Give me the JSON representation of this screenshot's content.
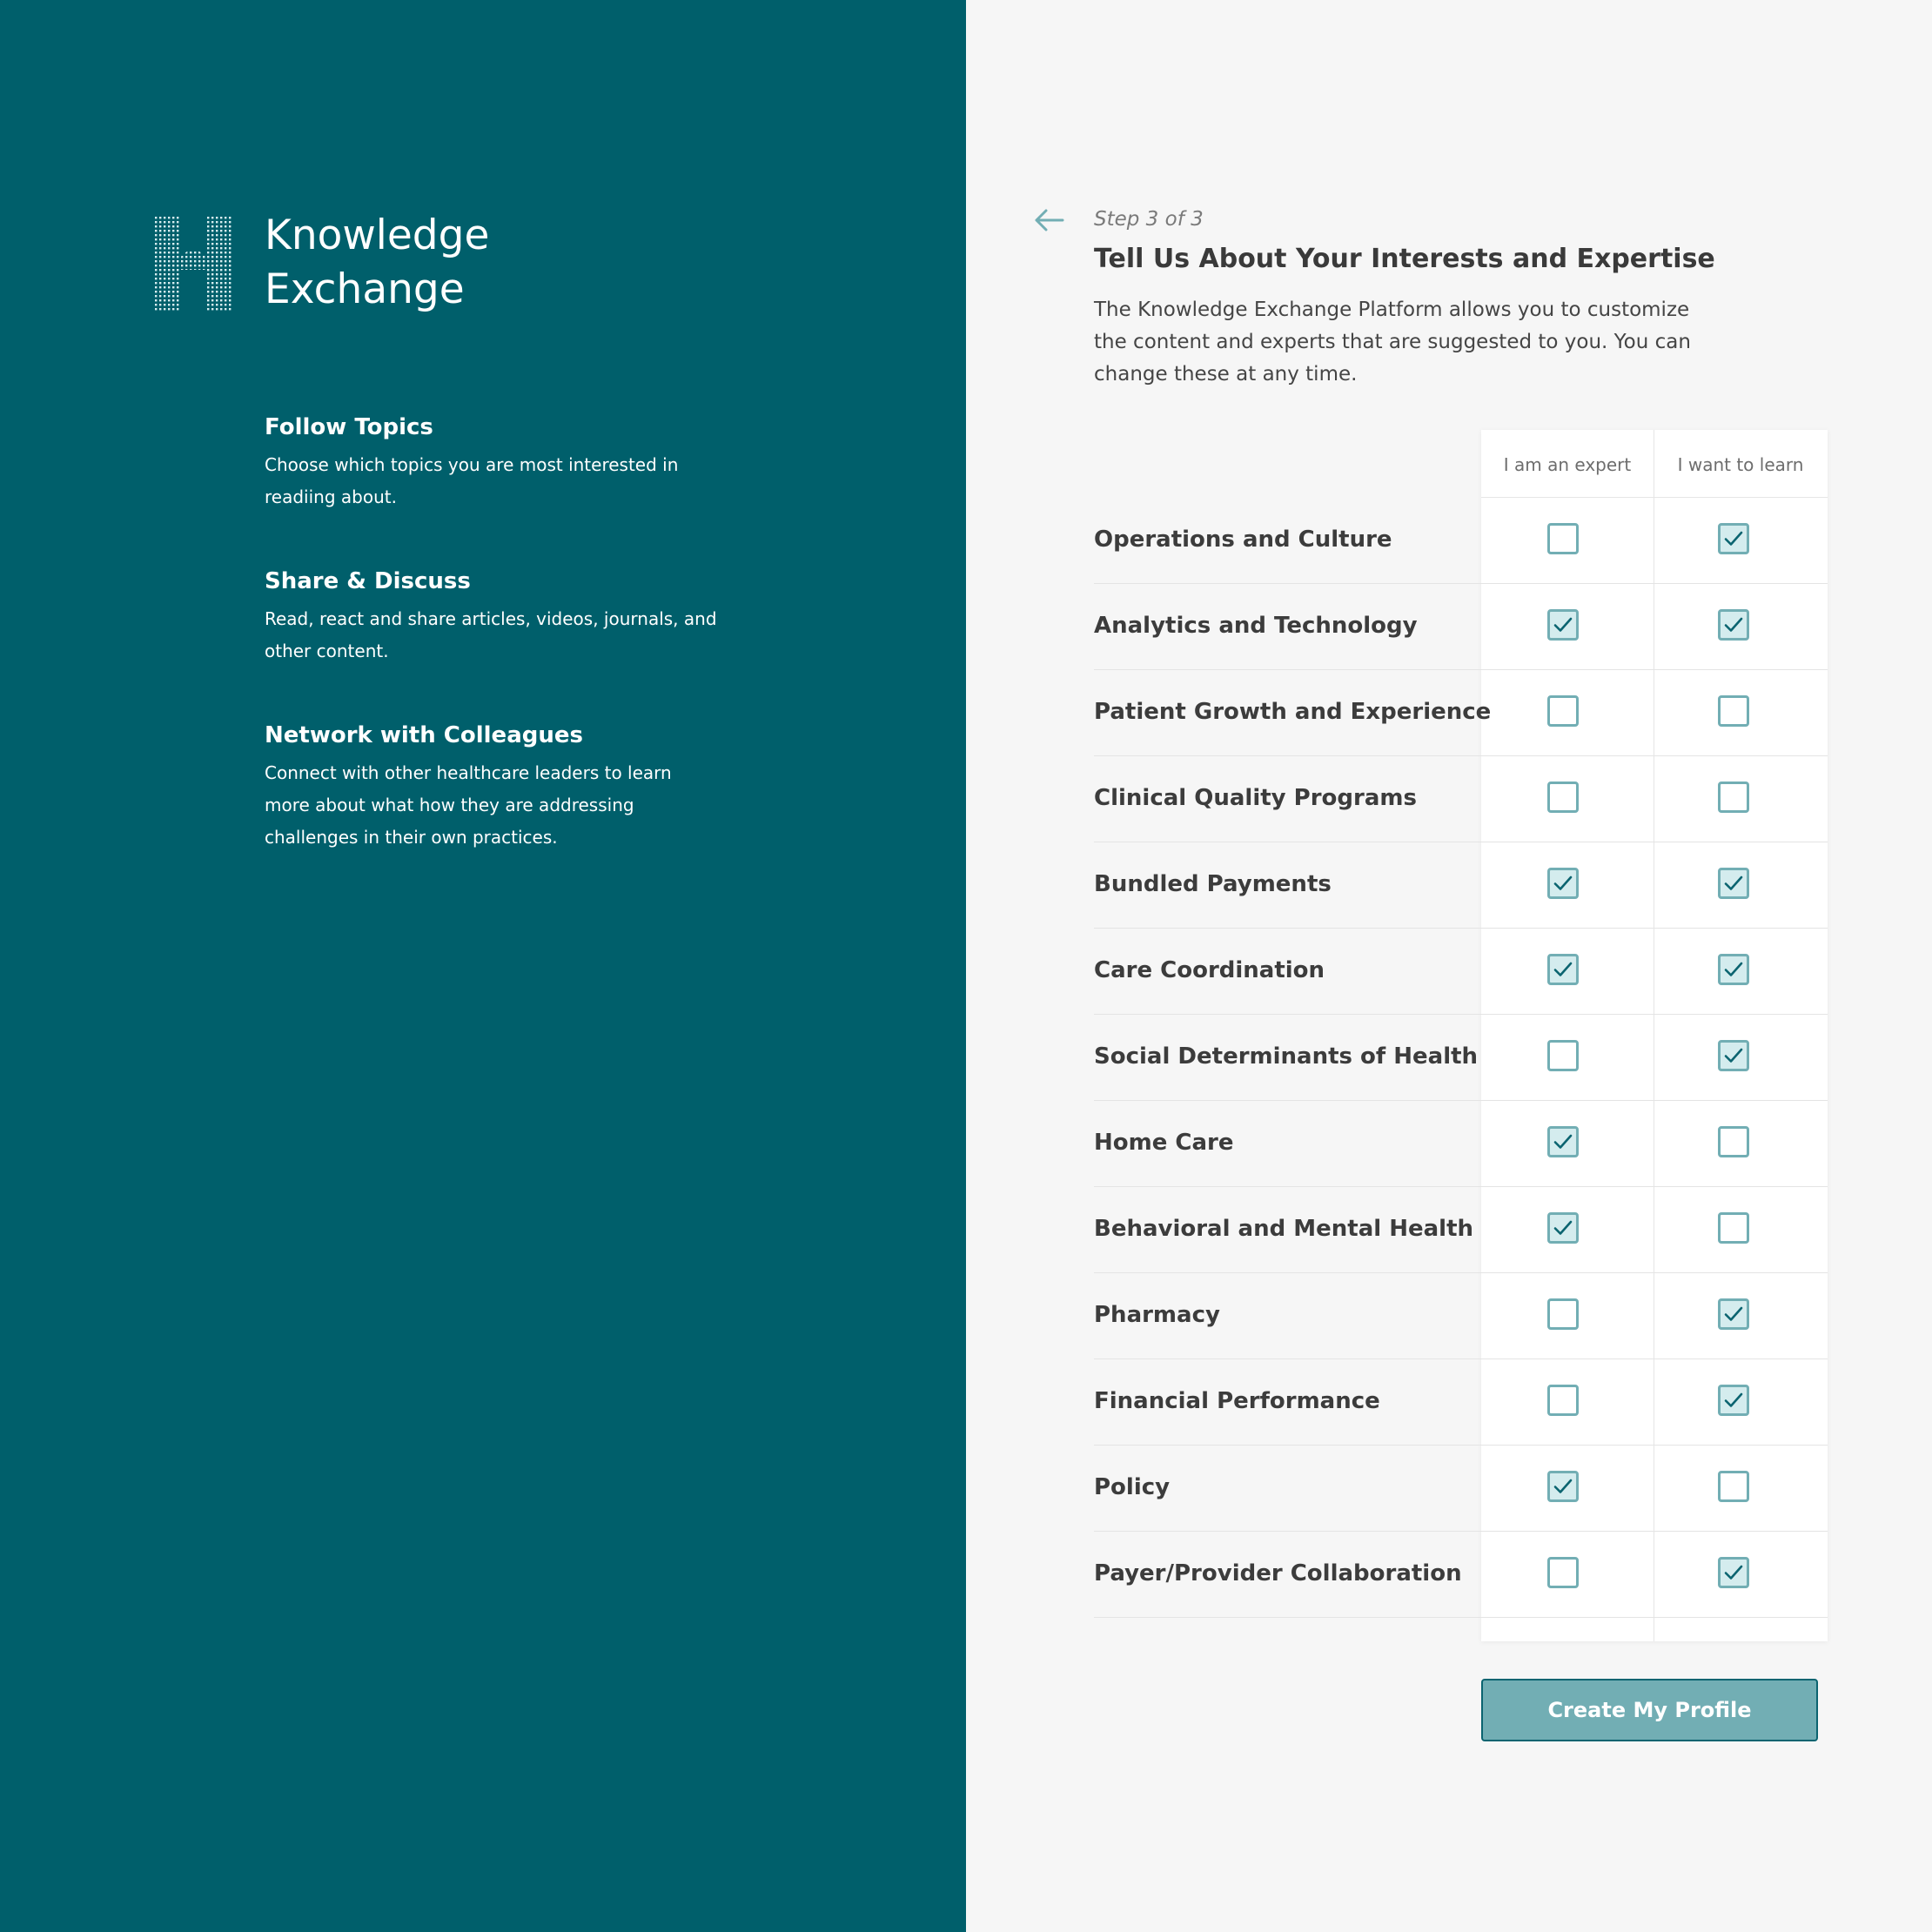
{
  "brand": {
    "line1": "Knowledge",
    "line2": "Exchange"
  },
  "features": [
    {
      "title": "Follow Topics",
      "text": "Choose which topics you are most interested in readiing about."
    },
    {
      "title": "Share & Discuss",
      "text": "Read, react and share articles, videos, journals, and other content."
    },
    {
      "title": "Network with Colleagues",
      "text": "Connect with other healthcare leaders to learn more about what how they are addressing challenges in their own practices."
    }
  ],
  "step": "Step 3 of 3",
  "title": "Tell Us About Your Interests and Expertise",
  "description": "The Knowledge Exchange Platform allows you to customize the content and experts that are suggested to you. You can change these at any time.",
  "columns": {
    "expert": "I am an expert",
    "learn": "I want to learn"
  },
  "topics": [
    {
      "label": "Operations and Culture",
      "expert": false,
      "learn": true
    },
    {
      "label": "Analytics and Technology",
      "expert": true,
      "learn": true
    },
    {
      "label": "Patient Growth and Experience",
      "expert": false,
      "learn": false
    },
    {
      "label": "Clinical Quality Programs",
      "expert": false,
      "learn": false
    },
    {
      "label": "Bundled Payments",
      "expert": true,
      "learn": true
    },
    {
      "label": "Care Coordination",
      "expert": true,
      "learn": true
    },
    {
      "label": "Social Determinants of Health",
      "expert": false,
      "learn": true
    },
    {
      "label": "Home Care",
      "expert": true,
      "learn": false
    },
    {
      "label": "Behavioral and Mental Health",
      "expert": true,
      "learn": false
    },
    {
      "label": "Pharmacy",
      "expert": false,
      "learn": true
    },
    {
      "label": "Financial Performance",
      "expert": false,
      "learn": true
    },
    {
      "label": "Policy",
      "expert": true,
      "learn": false
    },
    {
      "label": "Payer/Provider Collaboration",
      "expert": false,
      "learn": true
    }
  ],
  "submit_label": "Create My Profile",
  "colors": {
    "panel": "#005f6b",
    "accent": "#72aeb4",
    "check": "#0b6470"
  }
}
